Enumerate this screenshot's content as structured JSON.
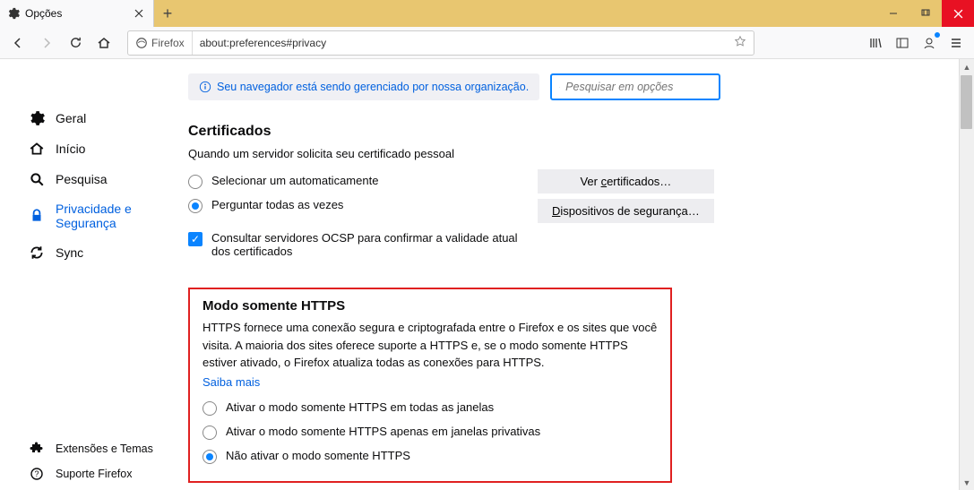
{
  "tab": {
    "title": "Opções"
  },
  "urlbar": {
    "identity": "Firefox",
    "url": "about:preferences#privacy"
  },
  "banner": {
    "text": "Seu navegador está sendo gerenciado por nossa organização."
  },
  "search": {
    "placeholder": "Pesquisar em opções"
  },
  "sidebar": {
    "items": [
      {
        "label": "Geral"
      },
      {
        "label": "Início"
      },
      {
        "label": "Pesquisa"
      },
      {
        "label": "Privacidade e Segurança"
      },
      {
        "label": "Sync"
      }
    ],
    "bottom": [
      {
        "label": "Extensões e Temas"
      },
      {
        "label": "Suporte Firefox"
      }
    ]
  },
  "certificates": {
    "title": "Certificados",
    "subtitle": "Quando um servidor solicita seu certificado pessoal",
    "option_auto": "Selecionar um automaticamente",
    "option_ask": "Perguntar todas as vezes",
    "ocsp": "Consultar servidores OCSP para confirmar a validade atual dos certificados",
    "btn_view_pre": "Ver ",
    "btn_view_key": "c",
    "btn_view_post": "ertificados…",
    "btn_devices_pre": "",
    "btn_devices_key": "D",
    "btn_devices_post": "ispositivos de segurança…"
  },
  "https": {
    "title": "Modo somente HTTPS",
    "desc": "HTTPS fornece uma conexão segura e criptografada entre o Firefox e os sites que você visita. A maioria dos sites oferece suporte a HTTPS e, se o modo somente HTTPS estiver ativado, o Firefox atualiza todas as conexões para HTTPS.",
    "learn": "Saiba mais",
    "opt_all": "Ativar o modo somente HTTPS em todas as janelas",
    "opt_private": "Ativar o modo somente HTTPS apenas em janelas privativas",
    "opt_off": "Não ativar o modo somente HTTPS"
  }
}
